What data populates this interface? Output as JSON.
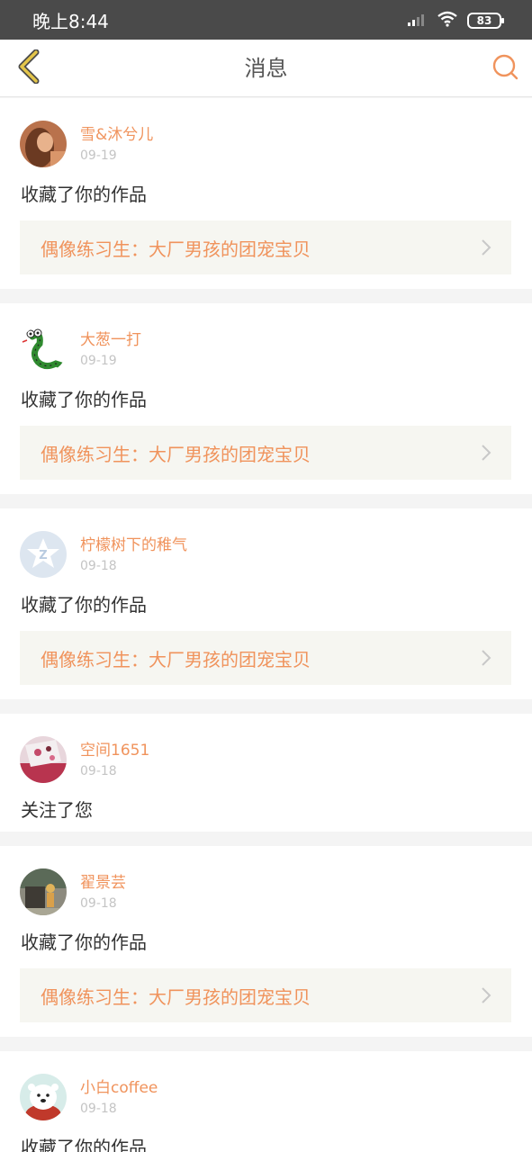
{
  "status_bar": {
    "time": "晚上8:44",
    "battery": "83",
    "icons": [
      "signal-icon",
      "wifi-icon",
      "battery-icon"
    ]
  },
  "header": {
    "title": "消息",
    "back_icon": "chevron-left-icon",
    "search_icon": "search-icon"
  },
  "colors": {
    "accent": "#f0935c",
    "back_icon": "#e3c54a",
    "card_link_bg": "#f6f6f1",
    "date": "#c4c4c4"
  },
  "messages": [
    {
      "user": "雪&沐兮儿",
      "date": "09-19",
      "action": "收藏了你的作品",
      "work": "偶像练习生：大厂男孩的团宠宝贝"
    },
    {
      "user": "大葱一打",
      "date": "09-19",
      "action": "收藏了你的作品",
      "work": "偶像练习生：大厂男孩的团宠宝贝"
    },
    {
      "user": "柠檬树下的稚气",
      "date": "09-18",
      "action": "收藏了你的作品",
      "work": "偶像练习生：大厂男孩的团宠宝贝"
    },
    {
      "user": "空间1651",
      "date": "09-18",
      "action": "关注了您"
    },
    {
      "user": "翟景芸",
      "date": "09-18",
      "action": "收藏了你的作品",
      "work": "偶像练习生：大厂男孩的团宠宝贝"
    },
    {
      "user": "小白coffee",
      "date": "09-18",
      "action": "收藏了你的作品"
    }
  ]
}
